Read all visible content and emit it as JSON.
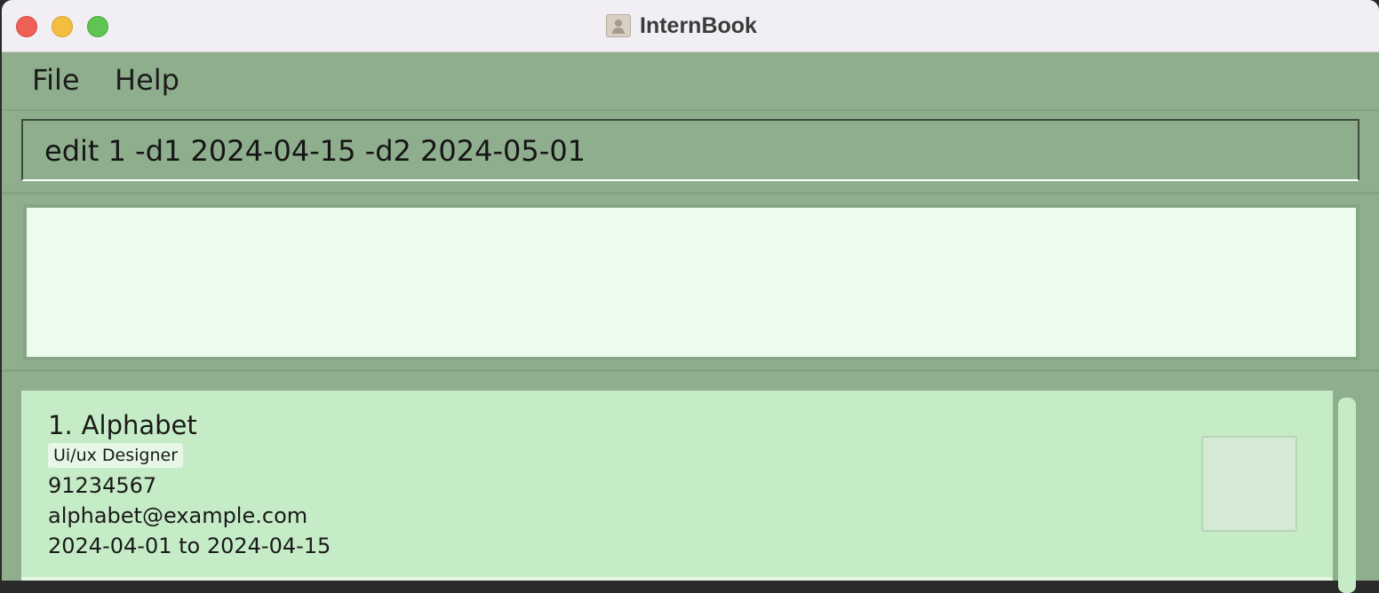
{
  "window": {
    "title": "InternBook"
  },
  "menu": {
    "file": "File",
    "help": "Help"
  },
  "command": {
    "value": "edit 1 -d1 2024-04-15 -d2 2024-05-01"
  },
  "result": {
    "text": ""
  },
  "interns": [
    {
      "index": "1.",
      "name": "Alphabet",
      "role": "Ui/ux Designer",
      "phone": "91234567",
      "email": "alphabet@example.com",
      "dates": "2024-04-01 to 2024-04-15"
    }
  ],
  "colors": {
    "background": "#8fae8d",
    "card": "#c5ecc6",
    "result_box": "#edfbee",
    "titlebar": "#f1eef4"
  }
}
